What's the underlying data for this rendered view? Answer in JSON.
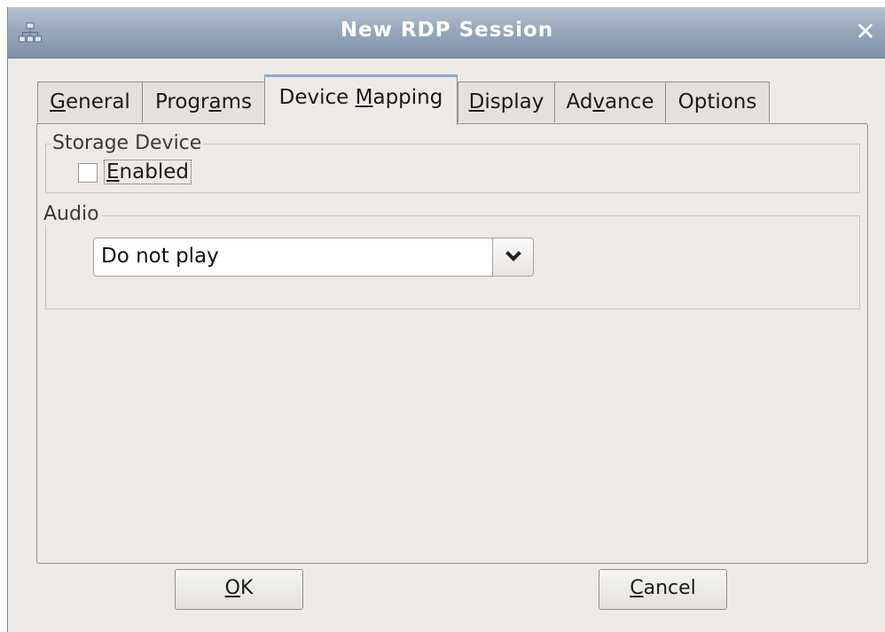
{
  "window": {
    "title": "New RDP Session",
    "close_symbol": "✕",
    "title_icon": "network-icon"
  },
  "tabs": [
    {
      "pre": "",
      "mnemonic": "G",
      "post": "eneral",
      "active": false
    },
    {
      "pre": "Progr",
      "mnemonic": "a",
      "post": "ms",
      "active": false
    },
    {
      "pre": "Device ",
      "mnemonic": "M",
      "post": "apping",
      "active": true
    },
    {
      "pre": "",
      "mnemonic": "D",
      "post": "isplay",
      "active": false
    },
    {
      "pre": "Ad",
      "mnemonic": "v",
      "post": "ance",
      "active": false
    },
    {
      "pre": "Options",
      "mnemonic": "",
      "post": "",
      "active": false
    }
  ],
  "storage": {
    "group_label": "Storage Device",
    "checkbox_mnemonic": "E",
    "checkbox_rest": "nabled",
    "checked": false
  },
  "audio": {
    "group_label": "Audio",
    "selected": "Do not play",
    "dropdown_icon": "chevron-down-icon"
  },
  "buttons": {
    "ok_mnemonic": "O",
    "ok_rest": "K",
    "cancel_mnemonic": "C",
    "cancel_rest": "ancel"
  },
  "colors": {
    "titlebar": "#97a8bc",
    "window_bg": "#ece9e6",
    "active_tab_accent": "#8ea8c9"
  }
}
